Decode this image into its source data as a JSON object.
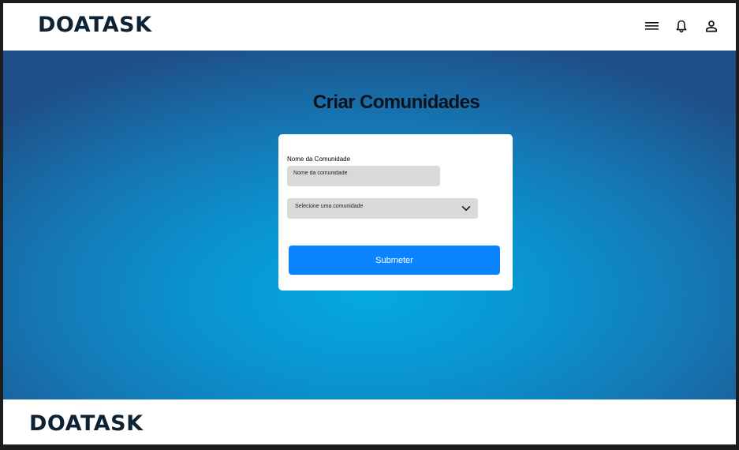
{
  "header": {
    "logo": "DOATASK",
    "icons": [
      "menu-icon",
      "bell-icon",
      "user-icon"
    ]
  },
  "main": {
    "title": "Criar Comunidades",
    "form": {
      "name_label": "Nome da Comunidade",
      "name_placeholder": "Nome da comunidade",
      "select_value": "Selecione uma comunidade",
      "submit_label": "Submeter"
    }
  },
  "footer": {
    "logo": "DOATASK"
  },
  "colors": {
    "primary_button": "#0a84ff",
    "logo_text": "#0d2235",
    "hero_center": "#05a9e2",
    "hero_edge": "#1f4f88"
  }
}
